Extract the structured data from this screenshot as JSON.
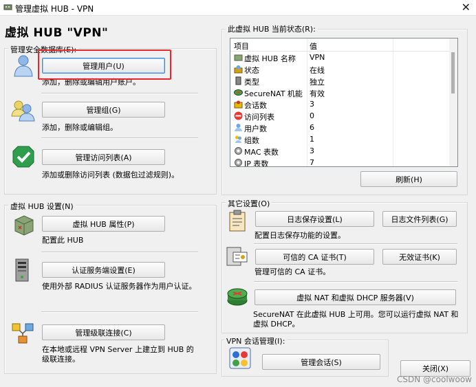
{
  "window": {
    "title": "管理虚拟 HUB - VPN",
    "close_glyph": "✕"
  },
  "hub_title": "虚拟 HUB \"VPN\"",
  "security_db": {
    "legend": "管理安全数据库(E):",
    "users_button": "管理用户(U)",
    "users_desc": "添加，删除或编辑用户账户。",
    "groups_button": "管理组(G)",
    "groups_desc": "添加，删除或编辑组。",
    "acl_button": "管理访问列表(A)",
    "acl_desc": "添加或删除访问列表 (数据包过滤规则)。"
  },
  "hub_settings": {
    "legend": "虚拟 HUB 设置(N)",
    "props_button": "虚拟 HUB 属性(P)",
    "props_desc": "配置此 HUB",
    "radius_button": "认证服务端设置(E)",
    "radius_desc": "使用外部 RADIUS 认证服务器作为用户认证。",
    "cascade_button": "管理级联连接(C)",
    "cascade_desc": "在本地或远程 VPN Server 上建立到 HUB 的级联连接。"
  },
  "status": {
    "legend": "此虚拟 HUB 当前状态(R):",
    "col_item": "项目",
    "col_value": "值",
    "rows": [
      {
        "key": "虚拟 HUB 名称",
        "value": "VPN",
        "icon": "hub-icon"
      },
      {
        "key": "状态",
        "value": "在线",
        "icon": "status-icon"
      },
      {
        "key": "类型",
        "value": "独立",
        "icon": "server-icon"
      },
      {
        "key": "SecureNAT 机能",
        "value": "有效",
        "icon": "router-icon"
      },
      {
        "key": "会话数",
        "value": "3",
        "icon": "session-icon"
      },
      {
        "key": "访问列表",
        "value": "0",
        "icon": "no-entry-icon"
      },
      {
        "key": "用户数",
        "value": "6",
        "icon": "user-icon"
      },
      {
        "key": "组数",
        "value": "1",
        "icon": "group-icon"
      },
      {
        "key": "MAC 表数",
        "value": "3",
        "icon": "gear-icon"
      },
      {
        "key": "IP 表数",
        "value": "7",
        "icon": "gear-icon"
      }
    ],
    "refresh_button": "刷新(H)"
  },
  "other": {
    "legend": "其它设置(O)",
    "log_button": "日志保存设置(L)",
    "logfiles_button": "日志文件列表(G)",
    "log_desc": "配置日志保存功能的设置。",
    "ca_button": "可信的 CA 证书(T)",
    "crl_button": "无效证书(K)",
    "ca_desc": "管理可信的 CA 证书。",
    "nat_button": "虚拟 NAT 和虚拟 DHCP 服务器(V)",
    "nat_desc": "SecureNAT 在此虚拟 HUB 上可用。您可以运行虚拟 NAT 和虚拟 DHCP。"
  },
  "sessions": {
    "legend": "VPN 会话管理(I):",
    "button": "管理会话(S)"
  },
  "close_button": "关闭(X)",
  "watermark": "CSDN @coolwoow",
  "colors": {
    "highlight_box": "#e8272d",
    "focus_border": "#3a8bd8"
  }
}
